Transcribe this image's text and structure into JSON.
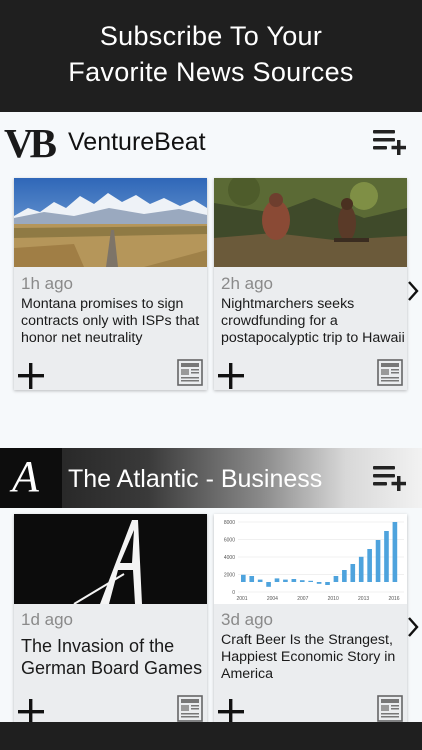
{
  "header": {
    "line1": "Subscribe To Your",
    "line2": "Favorite News Sources"
  },
  "sources": [
    {
      "name": "VentureBeat",
      "logo_text": "VB",
      "articles": [
        {
          "time": "1h ago",
          "title": "Montana promises to sign contracts only with ISPs that honor net neutrality"
        },
        {
          "time": "2h ago",
          "title": "Nightmarchers seeks crowdfunding for a postapocalyptic trip to Hawaii"
        }
      ]
    },
    {
      "name": "The Atlantic - Business",
      "logo_text": "A",
      "articles": [
        {
          "time": "1d ago",
          "title": "The Invasion of the German Board Games"
        },
        {
          "time": "3d ago",
          "title": "Craft Beer Is the Strangest, Happiest Economic Story in America"
        }
      ]
    }
  ],
  "chart_thumbnail": {
    "y_ticks": [
      "8000",
      "6000",
      "4000",
      "2000",
      "0"
    ],
    "x_ticks": [
      "2001",
      "2004",
      "2007",
      "2010",
      "2013",
      "2016"
    ]
  },
  "icons": {
    "add": "plus-icon",
    "reader": "newspaper-icon",
    "subscriptions": "playlist-add-icon",
    "next": "chevron-right-icon"
  },
  "colors": {
    "vb_red": "#b01e23",
    "bar_blue": "#4ea3dd"
  }
}
